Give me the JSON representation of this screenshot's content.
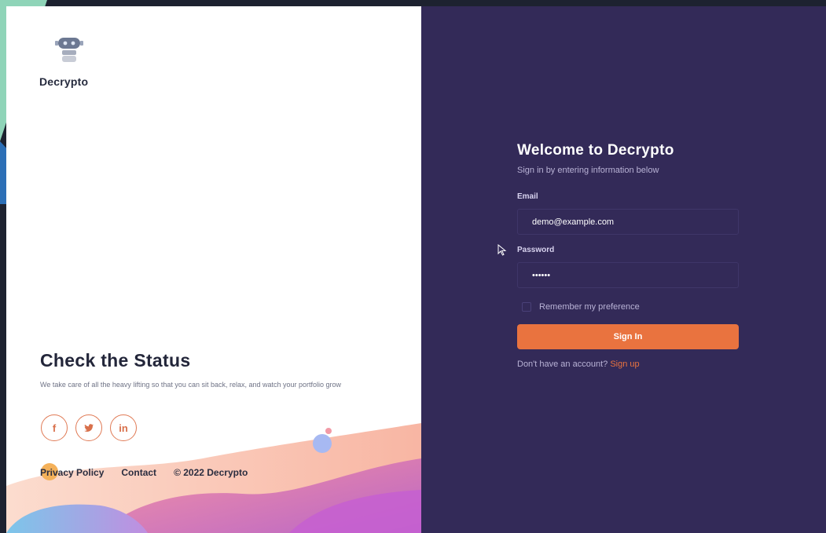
{
  "brand": {
    "name": "Decrypto",
    "logo_icon": "robot-head-icon"
  },
  "hero": {
    "title": "Check the Status",
    "description": "We take care of all the heavy lifting so that you can sit back, relax, and watch your portfolio grow"
  },
  "socials": [
    {
      "icon": "facebook-icon",
      "label": "f"
    },
    {
      "icon": "twitter-icon",
      "label": ""
    },
    {
      "icon": "linkedin-icon",
      "label": "in"
    }
  ],
  "footer": {
    "privacy": "Privacy Policy",
    "contact": "Contact",
    "copyright": "© 2022 Decrypto"
  },
  "form": {
    "title": "Welcome to Decrypto",
    "subtitle": "Sign in by entering information below",
    "email_label": "Email",
    "email_value": "demo@example.com",
    "password_label": "Password",
    "password_value": "••••••",
    "remember_label": "Remember my preference",
    "signin_label": "Sign In",
    "signup_prompt": "Don't have an account?",
    "signup_link": "Sign up"
  },
  "colors": {
    "panel_dark": "#332a58",
    "accent": "#e9733f",
    "app_bg": "#1d2230"
  }
}
